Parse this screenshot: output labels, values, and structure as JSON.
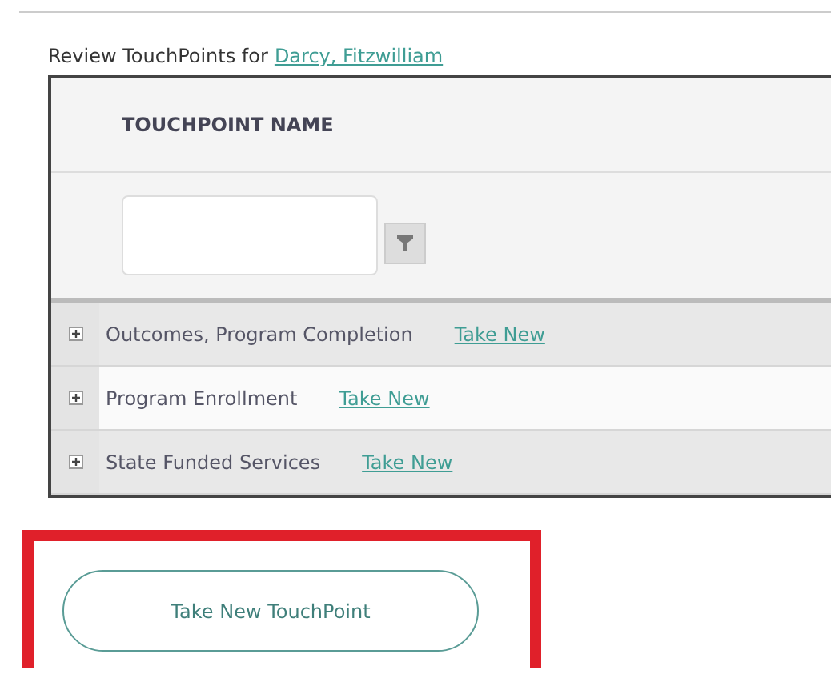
{
  "heading": {
    "text": "Review TouchPoints for",
    "link": "Darcy, Fitzwilliam"
  },
  "table": {
    "columns": [
      "TOUCHPOINT NAME"
    ],
    "rows": [
      {
        "name": "Outcomes, Program Completion",
        "action": "Take New",
        "expanded": false
      },
      {
        "name": "Program Enrollment",
        "action": "Take New",
        "expanded": false
      },
      {
        "name": "State Funded Services",
        "action": "Take New",
        "expanded": false
      }
    ]
  },
  "primary_button": {
    "label": "Take New TouchPoint",
    "highlighted": true
  }
}
